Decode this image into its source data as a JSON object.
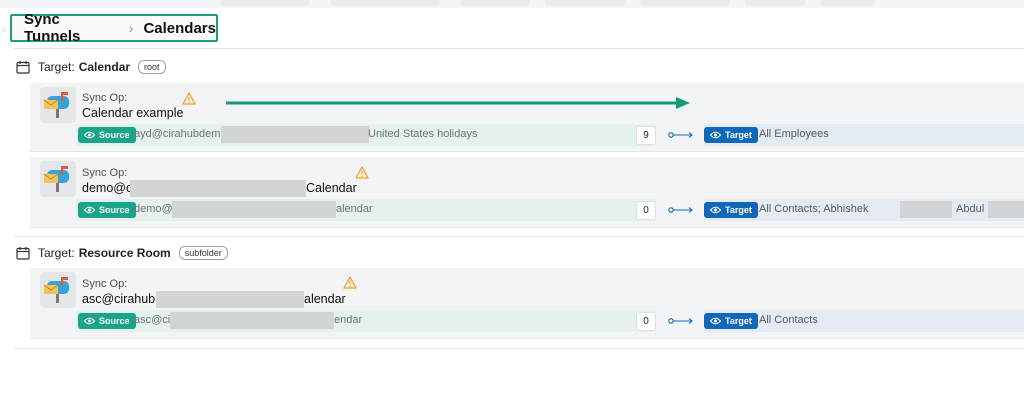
{
  "breadcrumb": {
    "root": "Sync Tunnels",
    "current": "Calendars"
  },
  "sections": [
    {
      "label": "Target:",
      "name": "Calendar",
      "chip": "root",
      "ops": [
        {
          "sync_label": "Sync Op:",
          "name_prefix": "Calendar example",
          "name_suffix": "",
          "source_badge": "Source",
          "source_prefix": "ayd@cirahubdem",
          "source_suffix": "United States holidays",
          "count": "9",
          "target_badge": "Target",
          "target_text": "All Employees"
        },
        {
          "sync_label": "Sync Op:",
          "name_prefix": "demo@c",
          "name_suffix": "Calendar",
          "source_badge": "Source",
          "source_prefix": "demo@",
          "source_suffix": "alendar",
          "count": "0",
          "target_badge": "Target",
          "target_text": "All Contacts; Abhishek",
          "target_text_2": "Abdul"
        }
      ]
    },
    {
      "label": "Target:",
      "name": "Resource Room",
      "chip": "subfolder",
      "ops": [
        {
          "sync_label": "Sync Op:",
          "name_prefix": "asc@cirahub",
          "name_suffix": "alendar",
          "source_badge": "Source",
          "source_prefix": "asc@ci",
          "source_suffix": "endar",
          "count": "0",
          "target_badge": "Target",
          "target_text": "All Contacts"
        }
      ]
    }
  ],
  "colors": {
    "highlight_border": "#1e9e7b",
    "source_badge": "#1aa58a",
    "target_badge": "#1167b8",
    "warning": "#f0a020",
    "annotation_arrow": "#14997a"
  },
  "icons": [
    "calendar-icon",
    "mailbox-icon",
    "warning-icon",
    "eye-icon",
    "flow-arrow-icon",
    "chevron-right-icon"
  ]
}
